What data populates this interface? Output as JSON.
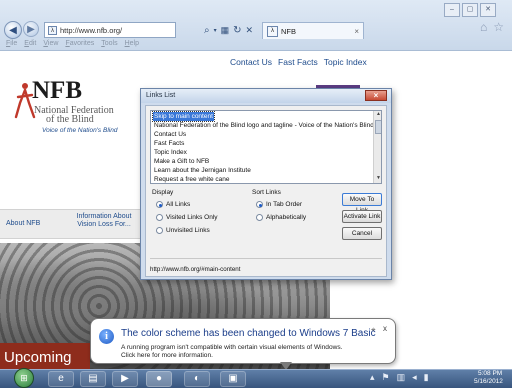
{
  "browser": {
    "address": "http://www.nfb.org/",
    "tab_title": "NFB",
    "tab_close": "×",
    "menus": [
      "File",
      "Edit",
      "View",
      "Favorites",
      "Tools",
      "Help"
    ]
  },
  "page": {
    "site_links": [
      "Contact Us",
      "Fast Facts",
      "Topic Index"
    ],
    "logo_title": "NFB",
    "logo_line1": "National Federation",
    "logo_line2": "of the Blind",
    "logo_tagline": "Voice of the Nation's Blind",
    "nav_about": "About NFB",
    "nav_info": "Information About Vision Loss For...",
    "upcoming": "Upcoming"
  },
  "dialog": {
    "title": "Links List",
    "close": "×",
    "links": [
      "Skip to main content",
      "National Federation of the Blind logo and tagline - Voice of the Nation's Blind",
      "Contact Us",
      "Fast Facts",
      "Topic Index",
      "Make a Gift to NFB",
      "Learn about the Jernigan Institute",
      "Request a free white cane"
    ],
    "selected_index": 0,
    "display_label": "Display",
    "display_options": [
      "All Links",
      "Visited Links Only",
      "Unvisited Links"
    ],
    "display_selected": 0,
    "sort_label": "Sort Links",
    "sort_options": [
      "In Tab Order",
      "Alphabetically"
    ],
    "sort_selected": 0,
    "buttons": {
      "move": "Move To Link",
      "activate": "Activate Link",
      "cancel": "Cancel"
    },
    "status_url": "http://www.nfb.org/#main-content"
  },
  "notification": {
    "title": "The color scheme has been changed to Windows 7 Basic",
    "message1": "A running program isn't compatible with certain visual elements of Windows.",
    "message2": "Click here for more information.",
    "close": "x"
  },
  "taskbar": {
    "time": "5:08 PM",
    "date": "5/16/2012"
  }
}
